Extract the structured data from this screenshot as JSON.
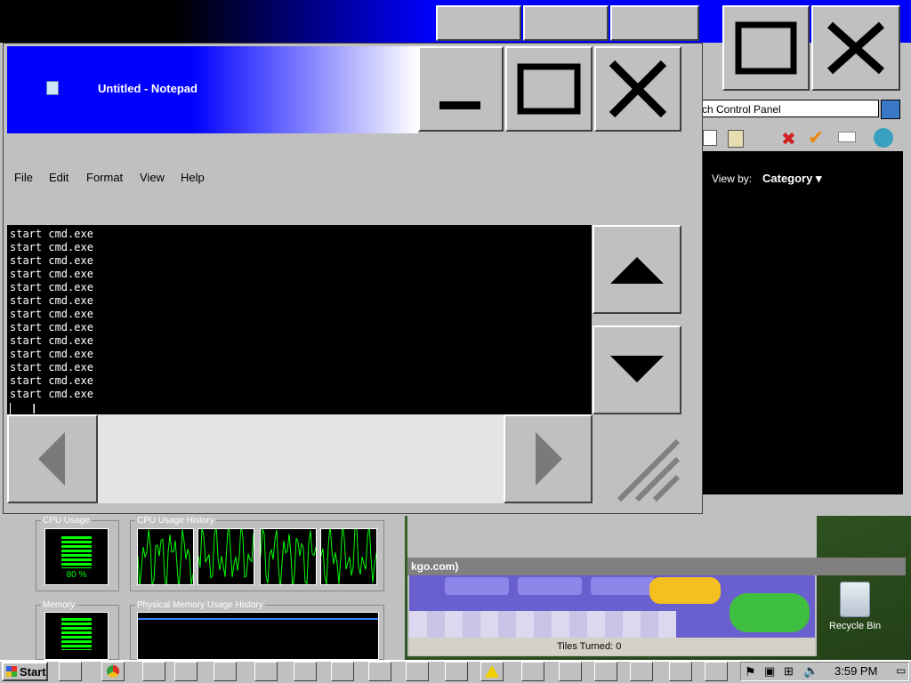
{
  "notepad": {
    "title": "Untitled - Notepad",
    "menu": [
      "File",
      "Edit",
      "Format",
      "View",
      "Help"
    ],
    "lines": [
      "start cmd.exe",
      "start cmd.exe",
      "start cmd.exe",
      "start cmd.exe",
      "start cmd.exe",
      "start cmd.exe",
      "start cmd.exe",
      "start cmd.exe",
      "start cmd.exe",
      "start cmd.exe",
      "start cmd.exe",
      "start cmd.exe",
      "start cmd.exe"
    ]
  },
  "control_panel": {
    "search_placeholder": "rch Control Panel",
    "view_by_label": "View by:",
    "view_by_value": "Category"
  },
  "task_manager": {
    "cpu_usage_label": "CPU Usage",
    "cpu_usage_value": "80 %",
    "cpu_history_label": "CPU Usage History",
    "memory_label": "Memory",
    "memory_history_label": "Physical Memory Usage History"
  },
  "game": {
    "title_fragment": "kgo.com)",
    "tiles_turned": "Tiles Turned: 0"
  },
  "desktop": {
    "recycle_bin_label": "Recycle Bin"
  },
  "taskbar": {
    "start_label": "Start",
    "clock": "3:59 PM"
  },
  "colors": {
    "title_blue": "#0000ff",
    "face": "#c0c0c0",
    "graph_green": "#00ff00"
  }
}
